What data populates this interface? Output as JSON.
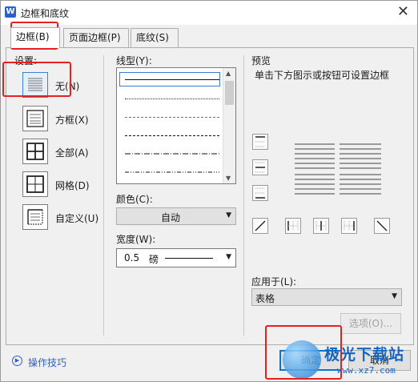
{
  "window": {
    "title": "边框和底纹",
    "app_icon": "W",
    "close_glyph": "✕"
  },
  "tabs": [
    {
      "label": "边框(B)",
      "active": true
    },
    {
      "label": "页面边框(P)",
      "active": false
    },
    {
      "label": "底纹(S)",
      "active": false
    }
  ],
  "settings": {
    "heading": "设置:",
    "items": [
      {
        "label": "无(N)",
        "icon": "border-none-icon",
        "selected": true
      },
      {
        "label": "方框(X)",
        "icon": "border-box-icon",
        "selected": false
      },
      {
        "label": "全部(A)",
        "icon": "border-all-icon",
        "selected": false
      },
      {
        "label": "网格(D)",
        "icon": "border-grid-icon",
        "selected": false
      },
      {
        "label": "自定义(U)",
        "icon": "border-custom-icon",
        "selected": false
      }
    ]
  },
  "line_style": {
    "label": "线型(Y):",
    "styles": [
      "solid",
      "dotted-fine",
      "dashed-short",
      "dashed",
      "dash-dot",
      "dash-dot-long"
    ]
  },
  "color": {
    "label": "颜色(C):",
    "value": "自动"
  },
  "width": {
    "label": "宽度(W):",
    "value": "0.5",
    "unit": "磅"
  },
  "preview": {
    "heading": "预览",
    "hint": "单击下方图示或按钮可设置边框"
  },
  "apply_to": {
    "label": "应用于(L):",
    "value": "表格"
  },
  "buttons": {
    "options": "选项(O)...",
    "ok": "确定",
    "cancel": "取消"
  },
  "help": {
    "label": "操作技巧"
  },
  "watermark": {
    "text": "极光下载站",
    "url": "www.xz7.com"
  },
  "colors": {
    "accent": "#0078d7",
    "highlight": "#e52020",
    "link": "#2b62c5"
  }
}
